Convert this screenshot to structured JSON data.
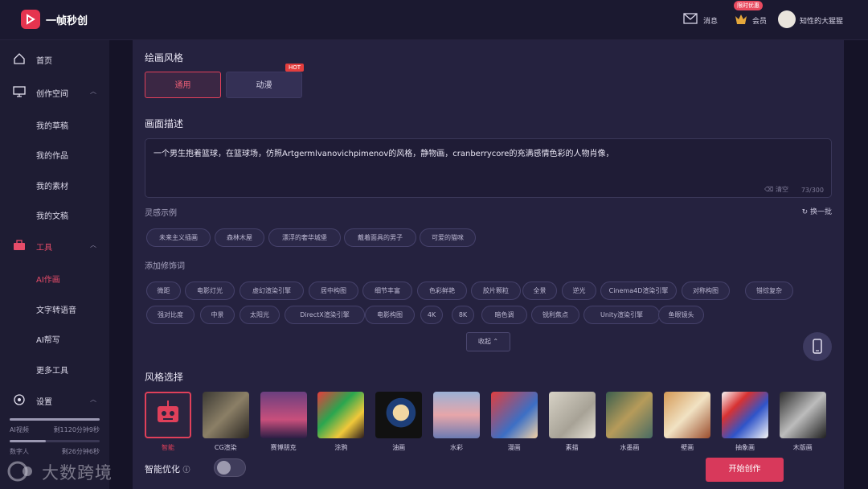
{
  "app": {
    "name": "一帧秒创"
  },
  "header": {
    "messages": "消息",
    "member": "会员",
    "promo": "限时优惠",
    "user": "知性的大猩猩"
  },
  "sidebar": {
    "items": [
      {
        "label": "首页",
        "icon": "home-icon"
      },
      {
        "label": "创作空间",
        "icon": "monitor-icon"
      },
      {
        "label": "我的草稿"
      },
      {
        "label": "我的作品"
      },
      {
        "label": "我的素材"
      },
      {
        "label": "我的文稿"
      },
      {
        "label": "工具",
        "icon": "toolbox-icon"
      },
      {
        "label": "AI作画"
      },
      {
        "label": "文字转语音"
      },
      {
        "label": "AI帮写"
      },
      {
        "label": "更多工具"
      },
      {
        "label": "设置",
        "icon": "settings-icon"
      }
    ],
    "usage": [
      {
        "label": "AI视频",
        "value": "剩1120分钟9秒",
        "fraction": 1.0
      },
      {
        "label": "数字人",
        "value": "剩26分钟6秒",
        "fraction": 0.4
      }
    ]
  },
  "form": {
    "style_title": "绘画风格",
    "tabs": [
      {
        "label": "通用"
      },
      {
        "label": "动漫"
      }
    ],
    "hot": "HOT",
    "desc_title": "画面描述",
    "description": "一个男生抱着篮球，在篮球场，仿照Artgermlvanovichpimenov的风格，静物画，cranberrycore的充满感情色彩的人物肖像，",
    "clear": "清空",
    "counter": "73/300",
    "inspiration_title": "灵感示例",
    "refresh": "换一批",
    "inspiration": [
      "未来主义插画",
      "森林木屋",
      "漂浮的奢华城堡",
      "戴着面具的男子",
      "可爱的猫咪"
    ],
    "modifier_title": "添加修饰词",
    "modifiers": [
      "微距",
      "电影灯光",
      "虚幻渲染引擎",
      "居中构图",
      "细节丰富",
      "色彩鲜艳",
      "胶片颗粒",
      "全景",
      "逆光",
      "Cinema4D渲染引擎",
      "对称构图",
      "错综复杂",
      "强对比度",
      "中景",
      "太阳光",
      "DirectX渲染引擎",
      "电影构图",
      "4K",
      "8K",
      "暗色调",
      "锐利焦点",
      "Unity渲染引擎",
      "鱼眼镜头"
    ],
    "collapse": "收起",
    "style_select_title": "风格选择",
    "styles": [
      {
        "name": "智能"
      },
      {
        "name": "CG渲染"
      },
      {
        "name": "赛博朋克"
      },
      {
        "name": "涂鸦"
      },
      {
        "name": "油画"
      },
      {
        "name": "水彩"
      },
      {
        "name": "漫画"
      },
      {
        "name": "素描"
      },
      {
        "name": "水墨画"
      },
      {
        "name": "壁画"
      },
      {
        "name": "抽象画"
      },
      {
        "name": "木版画"
      }
    ],
    "smart_opt": "智能优化",
    "start": "开始创作"
  },
  "watermark": "大数跨境"
}
